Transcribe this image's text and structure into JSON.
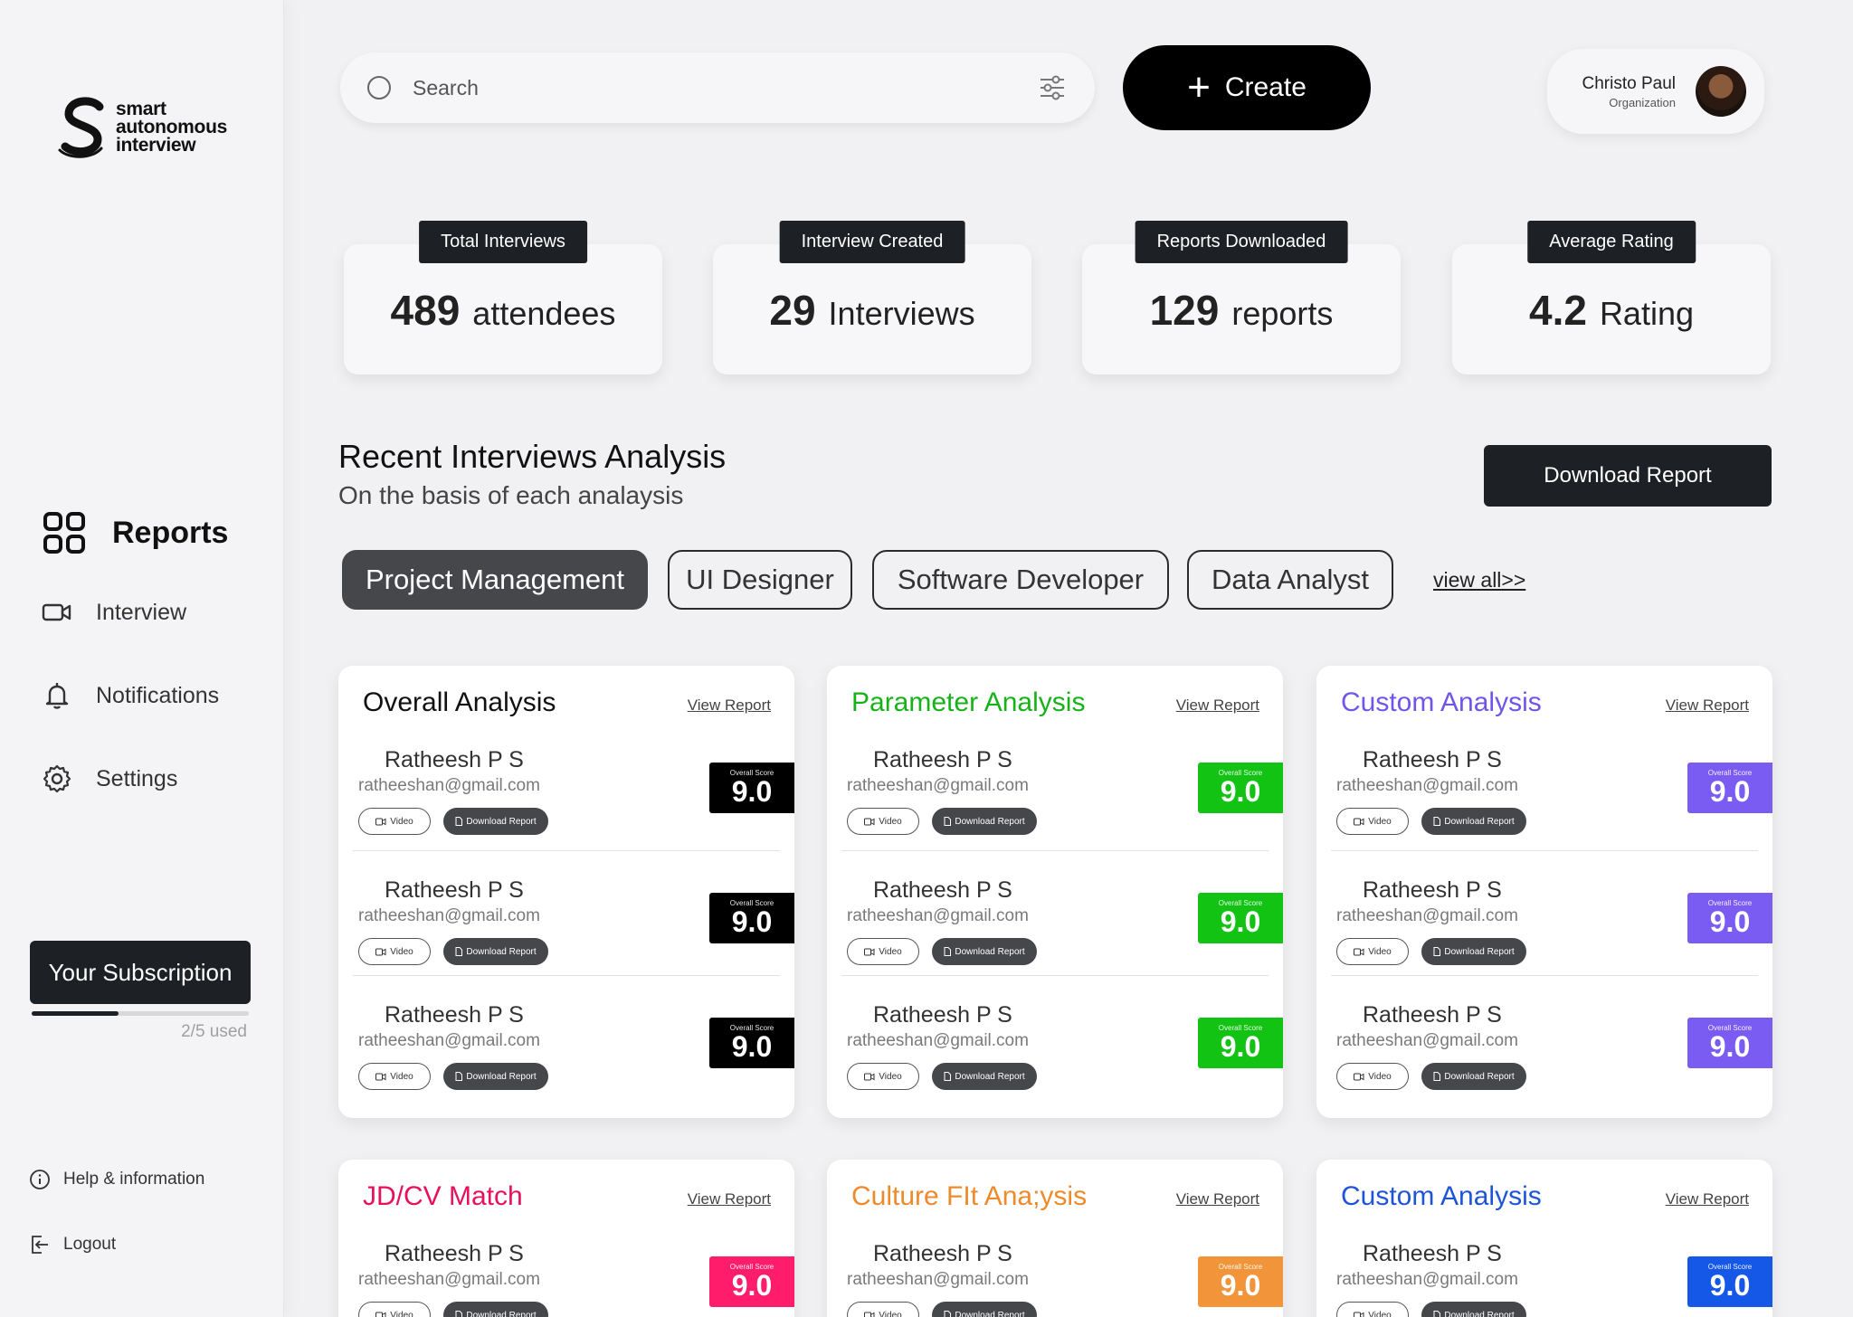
{
  "brand": {
    "line1": "smart",
    "line2": "autonomous",
    "line3": "interview"
  },
  "sidebar": {
    "reports_label": "Reports",
    "items": [
      {
        "label": "Interview",
        "icon": "video-icon"
      },
      {
        "label": "Notifications",
        "icon": "bell-icon"
      },
      {
        "label": "Settings",
        "icon": "gear-icon"
      }
    ],
    "subscription": {
      "label": "Your Subscription",
      "used_text": "2/5 used",
      "used": 2,
      "total": 5
    },
    "help_label": "Help & information",
    "logout_label": "Logout"
  },
  "header": {
    "search_placeholder": "Search",
    "create_label": "Create",
    "user": {
      "name": "Christo Paul",
      "role": "Organization"
    }
  },
  "stats": [
    {
      "tag": "Total Interviews",
      "value": "489",
      "unit": "attendees"
    },
    {
      "tag": "Interview Created",
      "value": "29",
      "unit": "Interviews"
    },
    {
      "tag": "Reports Downloaded",
      "value": "129",
      "unit": "reports"
    },
    {
      "tag": "Average Rating",
      "value": "4.2",
      "unit": "Rating"
    }
  ],
  "section": {
    "title": "Recent Interviews Analysis",
    "subtitle": "On the basis of each analaysis",
    "download_label": "Download Report"
  },
  "tabs": [
    "Project Management",
    "UI Designer",
    "Software Developer",
    "Data Analyst"
  ],
  "view_all": "view all>>",
  "card_common": {
    "view_report": "View Report",
    "video_label": "Video",
    "download_label": "Download Report",
    "score_label": "Overall Score"
  },
  "cards": [
    {
      "title": "Overall Analysis",
      "color": "#111111",
      "score_color": "#000000",
      "rows": [
        {
          "name": "Ratheesh P S",
          "email": "ratheeshan@gmail.com",
          "score": "9.0"
        },
        {
          "name": "Ratheesh P S",
          "email": "ratheeshan@gmail.com",
          "score": "9.0"
        },
        {
          "name": "Ratheesh P S",
          "email": "ratheeshan@gmail.com",
          "score": "9.0"
        }
      ]
    },
    {
      "title": "Parameter Analysis",
      "color": "#17b21a",
      "score_color": "#12c314",
      "rows": [
        {
          "name": "Ratheesh P S",
          "email": "ratheeshan@gmail.com",
          "score": "9.0"
        },
        {
          "name": "Ratheesh P S",
          "email": "ratheeshan@gmail.com",
          "score": "9.0"
        },
        {
          "name": "Ratheesh P S",
          "email": "ratheeshan@gmail.com",
          "score": "9.0"
        }
      ]
    },
    {
      "title": "Custom Analysis",
      "color": "#7155e8",
      "score_color": "#7a5cf2",
      "rows": [
        {
          "name": "Ratheesh P S",
          "email": "ratheeshan@gmail.com",
          "score": "9.0"
        },
        {
          "name": "Ratheesh P S",
          "email": "ratheeshan@gmail.com",
          "score": "9.0"
        },
        {
          "name": "Ratheesh P S",
          "email": "ratheeshan@gmail.com",
          "score": "9.0"
        }
      ]
    },
    {
      "title": "JD/CV Match",
      "color": "#e8105a",
      "score_color": "#ff1c6a",
      "rows": [
        {
          "name": "Ratheesh P S",
          "email": "ratheeshan@gmail.com",
          "score": "9.0"
        }
      ]
    },
    {
      "title": "Culture FIt Ana;ysis",
      "color": "#ef8a2c",
      "score_color": "#f2953a",
      "rows": [
        {
          "name": "Ratheesh P S",
          "email": "ratheeshan@gmail.com",
          "score": "9.0"
        }
      ]
    },
    {
      "title": "Custom Analysis",
      "color": "#1e55d6",
      "score_color": "#1557e6",
      "rows": [
        {
          "name": "Ratheesh P S",
          "email": "ratheeshan@gmail.com",
          "score": "9.0"
        }
      ]
    }
  ]
}
